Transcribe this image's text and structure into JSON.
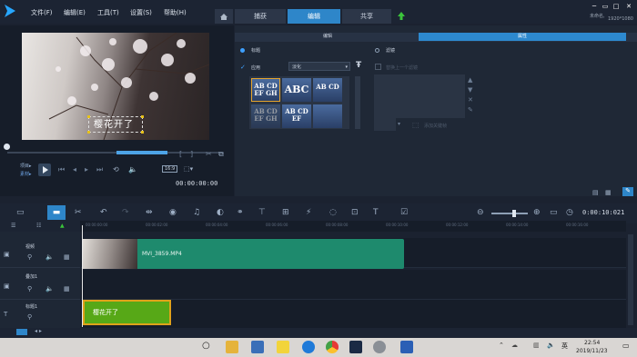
{
  "menu": {
    "file": "文件(F)",
    "edit": "编辑(E)",
    "tools": "工具(T)",
    "settings": "设置(S)",
    "help": "帮助(H)"
  },
  "tabs": {
    "capture": "捕获",
    "edit": "编辑",
    "share": "共享"
  },
  "project": {
    "name": "未命名,",
    "resolution": "1920*1080"
  },
  "preview": {
    "overlay_text": "樱花开了",
    "project_label": "项目▸",
    "material_label": "素材▸",
    "aspect_ratio": "16:9",
    "timecode": "00:00:00:00"
  },
  "options": {
    "edit_tab": "编辑",
    "properties_tab": "属性",
    "radio_title": "标题",
    "radio_filter": "滤镜",
    "apply_label": "应用",
    "preset": "淡化",
    "apply_to_prev_clip": "替换上一个滤镜",
    "add_mask": "添加关键帧",
    "tiles": [
      {
        "lines": [
          "AB CD",
          "EF GH"
        ]
      },
      {
        "lines": [
          "ABC"
        ]
      },
      {
        "lines": [
          "AB CD"
        ]
      },
      {
        "lines": [
          "AB CD",
          "EF GH"
        ]
      },
      {
        "lines": [
          "AB CD",
          "EF"
        ]
      },
      {
        "lines": [
          ""
        ]
      }
    ]
  },
  "timeline": {
    "timecode": "0:00:10:021",
    "ticks": [
      "00:00:00:00",
      "00:00:02:00",
      "00:00:04:00",
      "00:00:06:00",
      "00:00:08:00",
      "00:00:10:00",
      "00:00:12:00",
      "00:00:14:00",
      "00:00:16:00"
    ],
    "tracks": [
      {
        "name": "视频"
      },
      {
        "name": "叠加1"
      },
      {
        "name": "标题1"
      }
    ],
    "video_clip": "MVI_3859.MP4",
    "title_clip": "樱花开了"
  },
  "taskbar": {
    "time": "22:54",
    "date": "2019/11/23",
    "lang": "英"
  },
  "colors": {
    "accent": "#2e86c9",
    "video_clip": "#1e8a6d",
    "title_clip": "#57a817"
  }
}
